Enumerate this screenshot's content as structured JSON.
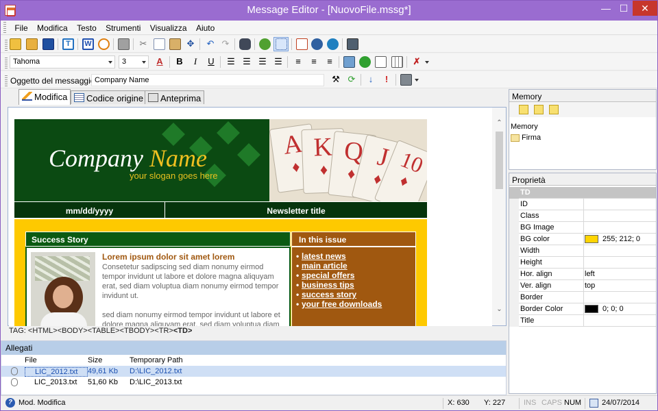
{
  "window": {
    "title": "Message Editor - [NuovoFile.mssg*]",
    "min": "—",
    "max": "☐",
    "close": "✕"
  },
  "menu": [
    "File",
    "Modifica",
    "Testo",
    "Strumenti",
    "Visualizza",
    "Aiuto"
  ],
  "format_toolbar": {
    "font": "Tahoma",
    "size": "3",
    "bold": "B",
    "italic": "I",
    "underline": "U"
  },
  "subject": {
    "label": "Oggetto del messaggio:",
    "value": "Company Name"
  },
  "tabs": [
    {
      "label": "Modifica"
    },
    {
      "label": "Codice origine"
    },
    {
      "label": "Anteprima"
    }
  ],
  "newsletter": {
    "logo_a": "Company ",
    "logo_b": "Name",
    "slogan": "your slogan goes here",
    "cards": [
      "A",
      "K",
      "Q",
      "J",
      "10"
    ],
    "date": "mm/dd/yyyy",
    "newsletter_title": "Newsletter title",
    "section": "Success Story",
    "issue_header": "In this issue",
    "story_title": "Lorem ipsum dolor sit amet lorem",
    "story_p1": "Consetetur sadipscing sed diam nonumy eirmod tempor invidunt ut labore et dolore magna aliquyam erat, sed diam voluptua diam nonumy eirmod tempor invidunt ut.",
    "story_p2": "sed diam nonumy eirmod tempor invidunt ut labore et dolore magna aliquyam erat, sed diam voluptua diam",
    "issue_links": [
      "latest news",
      "main article",
      "special offers",
      "business tips",
      "success story",
      "your free downloads"
    ]
  },
  "tag_path": {
    "prefix": "TAG: <HTML><BODY><TABLE><TBODY><TR>",
    "current": "<TD>"
  },
  "attachments": {
    "title": "Allegati",
    "columns": [
      "File",
      "Size",
      "Temporary Path"
    ],
    "rows": [
      {
        "file": "LIC_2012.txt",
        "size": "49,61 Kb",
        "path": "D:\\LIC_2012.txt"
      },
      {
        "file": "LIC_2013.txt",
        "size": "51,60 Kb",
        "path": "D:\\LIC_2013.txt"
      }
    ]
  },
  "memory": {
    "title": "Memory",
    "root": "Memory",
    "item": "Firma"
  },
  "properties": {
    "title": "Proprietà",
    "element": "TD",
    "rows": [
      {
        "key": "ID",
        "value": ""
      },
      {
        "key": "Class",
        "value": ""
      },
      {
        "key": "BG Image",
        "value": ""
      },
      {
        "key": "BG color",
        "value": "255; 212; 0",
        "swatch": "#ffd400"
      },
      {
        "key": "Width",
        "value": ""
      },
      {
        "key": "Height",
        "value": ""
      },
      {
        "key": "Hor. align",
        "value": "left"
      },
      {
        "key": "Ver. align",
        "value": "top"
      },
      {
        "key": "Border",
        "value": ""
      },
      {
        "key": "Border Color",
        "value": "0; 0; 0",
        "swatch": "#000000"
      },
      {
        "key": "Title",
        "value": ""
      }
    ]
  },
  "status": {
    "mode": "Mod. Modifica",
    "x": "X: 630",
    "y": "Y: 227",
    "ins": "INS",
    "caps": "CAPS",
    "num": "NUM",
    "date": "24/07/2014"
  }
}
